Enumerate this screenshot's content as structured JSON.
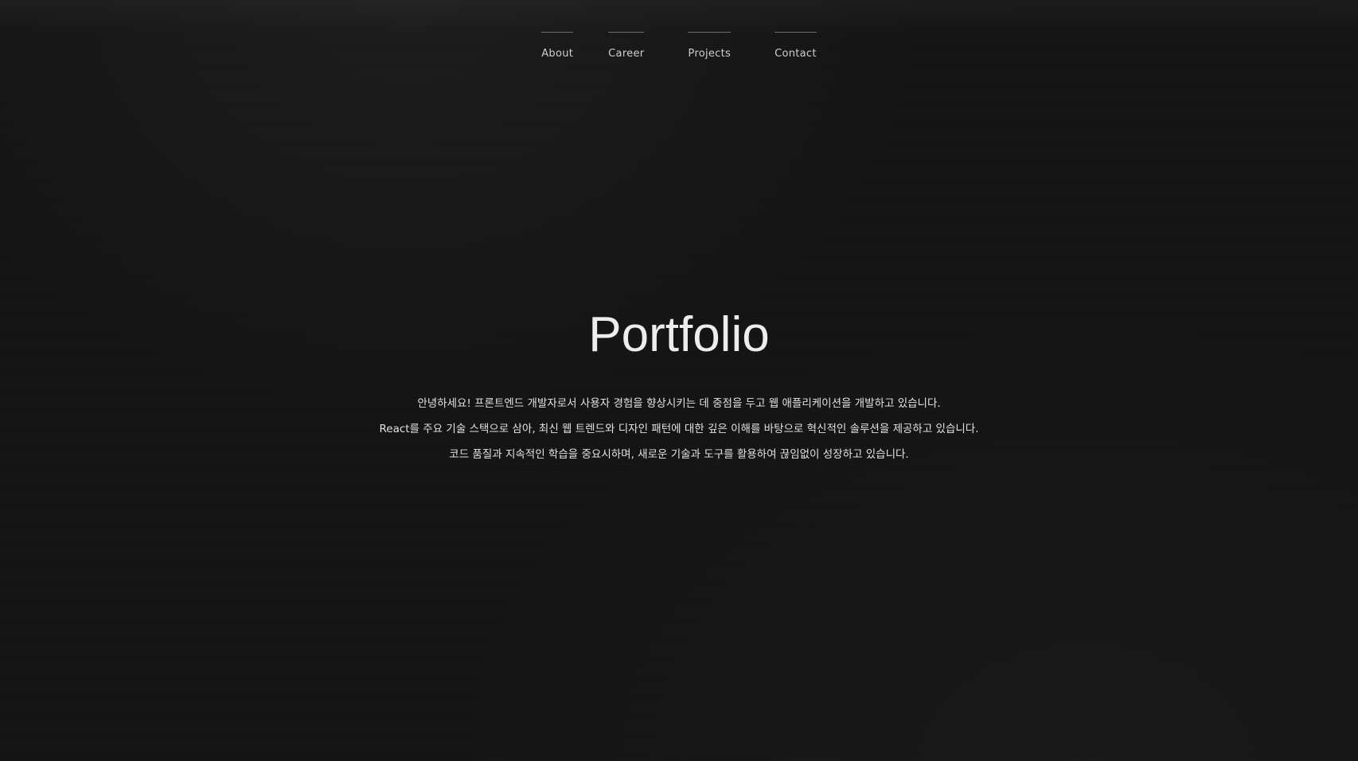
{
  "nav": {
    "items": [
      {
        "label": "About"
      },
      {
        "label": "Career"
      },
      {
        "label": "Projects"
      },
      {
        "label": "Contact"
      }
    ]
  },
  "hero": {
    "title": "Portfolio",
    "intro_lines": [
      "안녕하세요! 프론트엔드 개발자로서 사용자 경험을 향상시키는 데 중점을 두고 웹 애플리케이션을 개발하고 있습니다.",
      "React를 주요 기술 스택으로 삼아, 최신 웹 트렌드와 디자인 패턴에 대한 깊은 이해를 바탕으로 혁신적인 솔루션을 제공하고 있습니다.",
      "코드 품질과 지속적인 학습을 중요시하며, 새로운 기술과 도구를 활용하여 끊임없이 성장하고 있습니다."
    ]
  },
  "colors": {
    "background": "#141414",
    "text": "#e2e2e2",
    "nav_line": "#6e6e6e"
  }
}
